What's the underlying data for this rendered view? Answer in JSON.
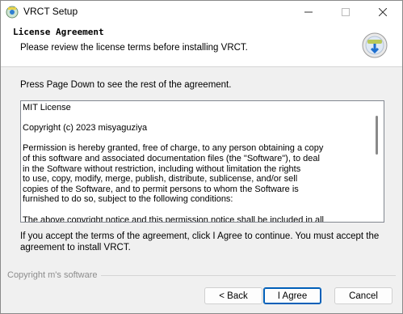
{
  "window": {
    "title": "VRCT Setup"
  },
  "header": {
    "title": "License Agreement",
    "subtitle": "Please review the license terms before installing VRCT."
  },
  "instruction": "Press Page Down to see the rest of the agreement.",
  "license": {
    "text": "MIT License\n\nCopyright (c) 2023 misyaguziya\n\nPermission is hereby granted, free of charge, to any person obtaining a copy\nof this software and associated documentation files (the \"Software\"), to deal\nin the Software without restriction, including without limitation the rights\nto use, copy, modify, merge, publish, distribute, sublicense, and/or sell\ncopies of the Software, and to permit persons to whom the Software is\nfurnished to do so, subject to the following conditions:\n\nThe above copyright notice and this permission notice shall be included in all"
  },
  "accept_text": "If you accept the terms of the agreement, click I Agree to continue. You must accept the agreement to install VRCT.",
  "branding": "Copyright m's software",
  "buttons": {
    "back": "< Back",
    "agree": "I Agree",
    "cancel": "Cancel"
  },
  "icons": {
    "app": "installer-icon",
    "logo": "install-disk-icon"
  },
  "colors": {
    "accent": "#005fb8"
  }
}
